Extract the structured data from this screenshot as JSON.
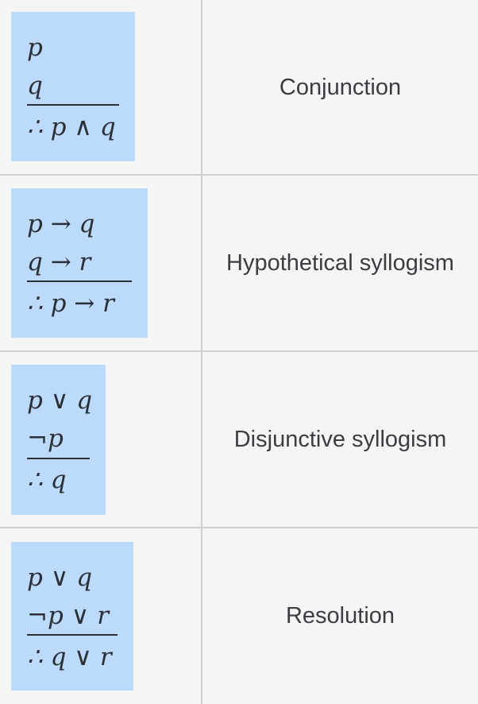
{
  "rules": [
    {
      "premises": [
        "p",
        "q"
      ],
      "conclusion": "∴ p ∧ q",
      "name": "Conjunction"
    },
    {
      "premises": [
        "p → q",
        "q → r"
      ],
      "conclusion": "∴ p → r",
      "name": "Hypothetical syllogism"
    },
    {
      "premises": [
        "p ∨ q",
        "¬p"
      ],
      "conclusion": "∴ q",
      "name": "Disjunctive syllogism"
    },
    {
      "premises": [
        "p ∨ q",
        "¬p ∨ r"
      ],
      "conclusion": "∴ q ∨ r",
      "name": "Resolution"
    }
  ],
  "colors": {
    "formula_background": "#bbdafc",
    "page_background": "#f5f5f5",
    "grid_line": "#cfcfcf"
  }
}
